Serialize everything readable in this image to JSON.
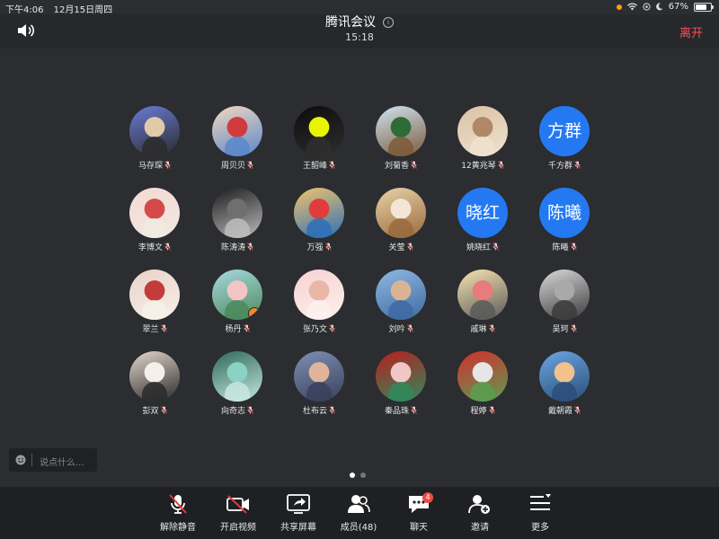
{
  "status": {
    "time": "下午4:06",
    "date": "12月15日周四",
    "battery": "67%"
  },
  "header": {
    "title": "腾讯会议",
    "duration": "15:18",
    "leave": "离开"
  },
  "participants": [
    {
      "name": "马存琛",
      "type": "photo",
      "colors": [
        "#6a7bd8",
        "#e2c9a8",
        "#2b2b2b"
      ]
    },
    {
      "name": "周贝贝",
      "type": "photo",
      "colors": [
        "#f2d7c0",
        "#d13b3b",
        "#5b87c9"
      ]
    },
    {
      "name": "王韶峰",
      "type": "photo",
      "colors": [
        "#0c0c0c",
        "#e9f500",
        "#2e2e2e"
      ]
    },
    {
      "name": "刘菊香",
      "type": "photo",
      "colors": [
        "#cfe3f2",
        "#2f6b36",
        "#7c5a3a"
      ]
    },
    {
      "name": "12黄兆琴",
      "type": "photo",
      "colors": [
        "#d9c2a6",
        "#b08866",
        "#f0e1cf"
      ]
    },
    {
      "name": "千方群",
      "type": "text",
      "text": "方群"
    },
    {
      "name": "李博文",
      "type": "photo",
      "colors": [
        "#f4d9d2",
        "#d44a4a",
        "#f0eae2"
      ]
    },
    {
      "name": "陈涛涛",
      "type": "photo",
      "colors": [
        "#1c1c1c",
        "#6f6f6f",
        "#bdbdbd"
      ]
    },
    {
      "name": "万强",
      "type": "photo",
      "colors": [
        "#f1c36b",
        "#e23b3b",
        "#2d6fb8"
      ]
    },
    {
      "name": "关莹",
      "type": "photo",
      "colors": [
        "#e8d2a8",
        "#f3e6d6",
        "#9a6a3c"
      ]
    },
    {
      "name": "姚晓红",
      "type": "text",
      "text": "晓红"
    },
    {
      "name": "陈曦",
      "type": "text",
      "text": "陈曦"
    },
    {
      "name": "翠兰",
      "type": "photo",
      "colors": [
        "#e9d3c8",
        "#c33c3c",
        "#f7f0ea"
      ]
    },
    {
      "name": "杨丹",
      "type": "photo",
      "colors": [
        "#a8d8e0",
        "#f3c4c4",
        "#4a8a5a"
      ],
      "host": true
    },
    {
      "name": "张乃文",
      "type": "photo",
      "colors": [
        "#f7d2d2",
        "#e9b7a6",
        "#fbf0ec"
      ]
    },
    {
      "name": "刘吟",
      "type": "photo",
      "colors": [
        "#8fb8e3",
        "#d8b493",
        "#3e6aa1"
      ]
    },
    {
      "name": "戚琳",
      "type": "photo",
      "colors": [
        "#f6e3b0",
        "#e87b7b",
        "#5a5a5a"
      ]
    },
    {
      "name": "吴珂",
      "type": "photo",
      "colors": [
        "#d9d9d9",
        "#a9a9a9",
        "#3b3b3b"
      ]
    },
    {
      "name": "彭双",
      "type": "photo",
      "colors": [
        "#e5d6cd",
        "#f4efe9",
        "#2a2a2a"
      ]
    },
    {
      "name": "向奇志",
      "type": "photo",
      "colors": [
        "#2d6a5a",
        "#8ad2c3",
        "#c7e7de"
      ]
    },
    {
      "name": "杜布云",
      "type": "photo",
      "colors": [
        "#7f8fb3",
        "#e1b49a",
        "#39405c"
      ]
    },
    {
      "name": "秦品珠",
      "type": "photo",
      "colors": [
        "#b81f1f",
        "#f3c6c6",
        "#2f8a5b"
      ]
    },
    {
      "name": "程婷",
      "type": "photo",
      "colors": [
        "#d32e2e",
        "#e6e6e6",
        "#5b9d51"
      ]
    },
    {
      "name": "戴朝霞",
      "type": "photo",
      "colors": [
        "#6aa6e0",
        "#f2c28a",
        "#2b4d7a"
      ]
    }
  ],
  "chat_input": {
    "placeholder": "说点什么..."
  },
  "toolbar": {
    "unmute": "解除静音",
    "video": "开启视频",
    "share": "共享屏幕",
    "members": "成员(48)",
    "chat": "聊天",
    "chat_badge": "4",
    "invite": "邀请",
    "more": "更多"
  },
  "icons": {
    "speaker": "speaker-icon",
    "info": "info-icon",
    "emoji": "emoji-icon"
  },
  "accent_colors": {
    "leave": "#ff4d4f",
    "avatar_blue": "#2479f2",
    "muted_red": "#e53935"
  }
}
